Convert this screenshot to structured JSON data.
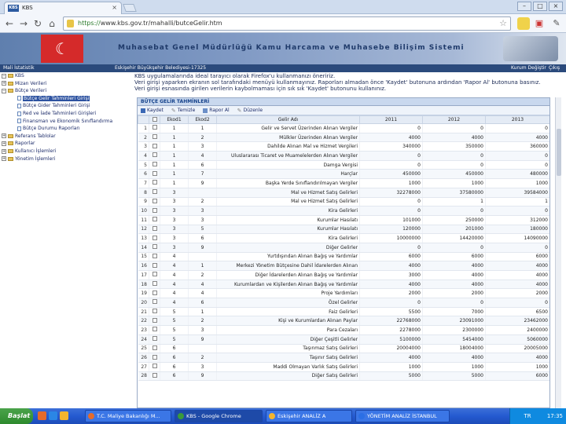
{
  "browser": {
    "tab_title": "KBS",
    "tab_favicon": "KBS",
    "url_scheme": "https://",
    "url_rest": "www.kbs.gov.tr/mahalli/butceGelir.htm"
  },
  "banner": {
    "title": "Muhasebat Genel Müdürlüğü Kamu Harcama ve Muhasebe Bilişim Sistemi"
  },
  "strip": {
    "left": "Mali İstatistik",
    "center": "Eskişehir Büyükşehir Belediyesi-17325",
    "user": "Kurum Değiştir",
    "exit": "Çıkış"
  },
  "sidebar": {
    "items": [
      {
        "label": "KBS",
        "level": 0,
        "pm": "−",
        "type": "folder"
      },
      {
        "label": "Mizan Verileri",
        "level": 0,
        "pm": "+",
        "type": "folder"
      },
      {
        "label": "Bütçe Verileri",
        "level": 0,
        "pm": "−",
        "type": "folder"
      },
      {
        "label": "Bütçe Gelir Tahminleri Girişi",
        "level": 1,
        "type": "doc",
        "selected": true
      },
      {
        "label": "Bütçe Gider Tahminleri Girişi",
        "level": 1,
        "type": "doc"
      },
      {
        "label": "Red ve İade Tahminleri Girişleri",
        "level": 1,
        "type": "doc"
      },
      {
        "label": "Finansman ve Ekonomik Sınıflandırma",
        "level": 1,
        "type": "doc"
      },
      {
        "label": "Bütçe Durumu Raporları",
        "level": 1,
        "type": "doc"
      },
      {
        "label": "Referans Tablolar",
        "level": 0,
        "pm": "+",
        "type": "folder"
      },
      {
        "label": "Raporlar",
        "level": 0,
        "pm": "+",
        "type": "folder"
      },
      {
        "label": "Kullanıcı İşlemleri",
        "level": 0,
        "pm": "+",
        "type": "folder"
      },
      {
        "label": "Yönetim İşlemleri",
        "level": 0,
        "pm": "+",
        "type": "folder"
      }
    ]
  },
  "message": {
    "line1": "KBS uygulamalarında ideal tarayıcı olarak Firefox'u kullanmanızı öneririz.",
    "line2": "Veri girişi yaparken ekranın sol tarafındaki menüyü kullanmayınız. Raporları almadan önce 'Kaydet' butonuna ardından 'Rapor Al' butonuna basınız.",
    "line3": "Veri girişi esnasında girilen verilerin kaybolmaması için sık sık 'Kaydet' butonunu kullanınız."
  },
  "panel": {
    "title": "BÜTÇE GELİR TAHMİNLERİ",
    "toolbar": [
      "Kaydet",
      "Temizle",
      "Rapor Al",
      "Düzenle"
    ],
    "columns": [
      "",
      "",
      "Ekod1",
      "Ekod2",
      "Gelir Adı",
      "2011",
      "2012",
      "2013"
    ],
    "rows": [
      [
        "1",
        "1",
        "1",
        "Gelir ve Servet Üzerinden Alınan Vergiler",
        "0",
        "0",
        "0"
      ],
      [
        "2",
        "1",
        "2",
        "Mülkler Üzerinden Alınan Vergiler",
        "4000",
        "4000",
        "4000"
      ],
      [
        "3",
        "1",
        "3",
        "Dahilde Alınan Mal ve Hizmet Vergileri",
        "340000",
        "350000",
        "360000"
      ],
      [
        "4",
        "1",
        "4",
        "Uluslararası Ticaret ve Muamelelerden Alınan Vergiler",
        "0",
        "0",
        "0"
      ],
      [
        "5",
        "1",
        "6",
        "Damga Vergisi",
        "0",
        "0",
        "0"
      ],
      [
        "6",
        "1",
        "7",
        "Harçlar",
        "450000",
        "450000",
        "480000"
      ],
      [
        "7",
        "1",
        "9",
        "Başka Yerde Sınıflandırılmayan Vergiler",
        "1000",
        "1000",
        "1000"
      ],
      [
        "8",
        "3",
        "",
        "Mal ve Hizmet Satış Gelirleri",
        "32278000",
        "37580000",
        "39584000"
      ],
      [
        "9",
        "3",
        "2",
        "Mal ve Hizmet Satış Gelirleri",
        "0",
        "1",
        "1"
      ],
      [
        "10",
        "3",
        "3",
        "Kira Gelirleri",
        "0",
        "0",
        "0"
      ],
      [
        "11",
        "3",
        "3",
        "Kurumlar Hasılatı",
        "101000",
        "250000",
        "312000"
      ],
      [
        "12",
        "3",
        "5",
        "Kurumlar Hasılatı",
        "120000",
        "201000",
        "180000"
      ],
      [
        "13",
        "3",
        "6",
        "Kira Gelirleri",
        "10000000",
        "14420000",
        "14090000"
      ],
      [
        "14",
        "3",
        "9",
        "Diğer Gelirler",
        "0",
        "0",
        "0"
      ],
      [
        "15",
        "4",
        "",
        "Yurtdışından Alınan Bağış ve Yardımlar",
        "6000",
        "6000",
        "6000"
      ],
      [
        "16",
        "4",
        "1",
        "Merkezi Yönetim Bütçesine Dahil İdarelerden Alınan",
        "4000",
        "4000",
        "4000"
      ],
      [
        "17",
        "4",
        "2",
        "Diğer İdarelerden Alınan Bağış ve Yardımlar",
        "3000",
        "4000",
        "4000"
      ],
      [
        "18",
        "4",
        "4",
        "Kurumlardan ve Kişilerden Alınan Bağış ve Yardımlar",
        "4000",
        "4000",
        "4000"
      ],
      [
        "19",
        "4",
        "4",
        "Proje Yardımları",
        "2000",
        "2000",
        "2000"
      ],
      [
        "20",
        "4",
        "6",
        "Özel Gelirler",
        "0",
        "0",
        "0"
      ],
      [
        "21",
        "5",
        "1",
        "Faiz Gelirleri",
        "5500",
        "7000",
        "6500"
      ],
      [
        "22",
        "5",
        "2",
        "Kişi ve Kurumlardan Alınan Paylar",
        "22768000",
        "23091000",
        "23462000"
      ],
      [
        "23",
        "5",
        "3",
        "Para Cezaları",
        "2278000",
        "2300000",
        "2400000"
      ],
      [
        "24",
        "5",
        "9",
        "Diğer Çeşitli Gelirler",
        "5100000",
        "5454000",
        "5060000"
      ],
      [
        "25",
        "6",
        "",
        "Taşınmaz Satış Gelirleri",
        "20004000",
        "18004000",
        "20005000"
      ],
      [
        "26",
        "6",
        "2",
        "Taşınır Satış Gelirleri",
        "4000",
        "4000",
        "4000"
      ],
      [
        "27",
        "6",
        "3",
        "Maddi Olmayan Varlık Satış Gelirleri",
        "1000",
        "1000",
        "1000"
      ],
      [
        "28",
        "6",
        "9",
        "Diğer Satış Gelirleri",
        "5000",
        "5000",
        "6000"
      ]
    ]
  },
  "taskbar": {
    "start": "Başlat",
    "tasks": [
      "T.C. Maliye Bakanlığı M...",
      "KBS - Google Chrome",
      "Eskişehir ANALİZ A",
      "YÖNETİM ANALİZ İSTANBUL"
    ],
    "lang": "TR",
    "clock": "17:35"
  }
}
